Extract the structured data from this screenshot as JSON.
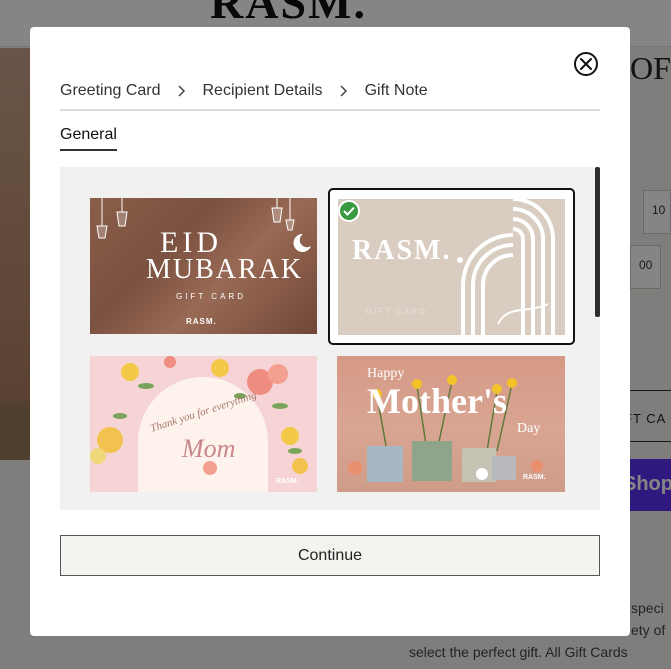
{
  "background": {
    "logo": "RASM.",
    "title_fragment": "OF",
    "amount_1": "10",
    "amount_2": "00",
    "gift_button_fragment": "FT CA",
    "shop_pay_fragment": "Shop",
    "description_lines": [
      "speci",
      "ety of",
      "select the perfect gift. All Gift Cards"
    ]
  },
  "modal": {
    "close_icon": "close-circle-icon",
    "breadcrumb": [
      {
        "label": "Greeting Card"
      },
      {
        "label": "Recipient Details"
      },
      {
        "label": "Gift Note"
      }
    ],
    "separator_icon": "chevron-right-icon",
    "tabs": [
      {
        "label": "General",
        "active": true
      }
    ],
    "cards": [
      {
        "id": "eid-mubarak",
        "lines": [
          "EID",
          "MUBARAK",
          "GIFT CARD",
          "RASM."
        ],
        "selected": false
      },
      {
        "id": "rasm-gift-card",
        "lines": [
          "RASM.",
          "GIFT CARD"
        ],
        "selected": true
      },
      {
        "id": "thank-you-mom",
        "lines": [
          "Thank you for everything",
          "Mom",
          "RASM."
        ],
        "selected": false
      },
      {
        "id": "happy-mothers-day",
        "lines": [
          "Happy",
          "Mother's",
          "Day",
          "RASM."
        ],
        "selected": false
      }
    ],
    "selected_icon": "check-circle-icon",
    "continue_label": "Continue"
  },
  "colors": {
    "selected_check": "#3a9a3f",
    "overlay": "rgba(0,0,0,0.48)",
    "shop_pay": "#5a31f4"
  }
}
